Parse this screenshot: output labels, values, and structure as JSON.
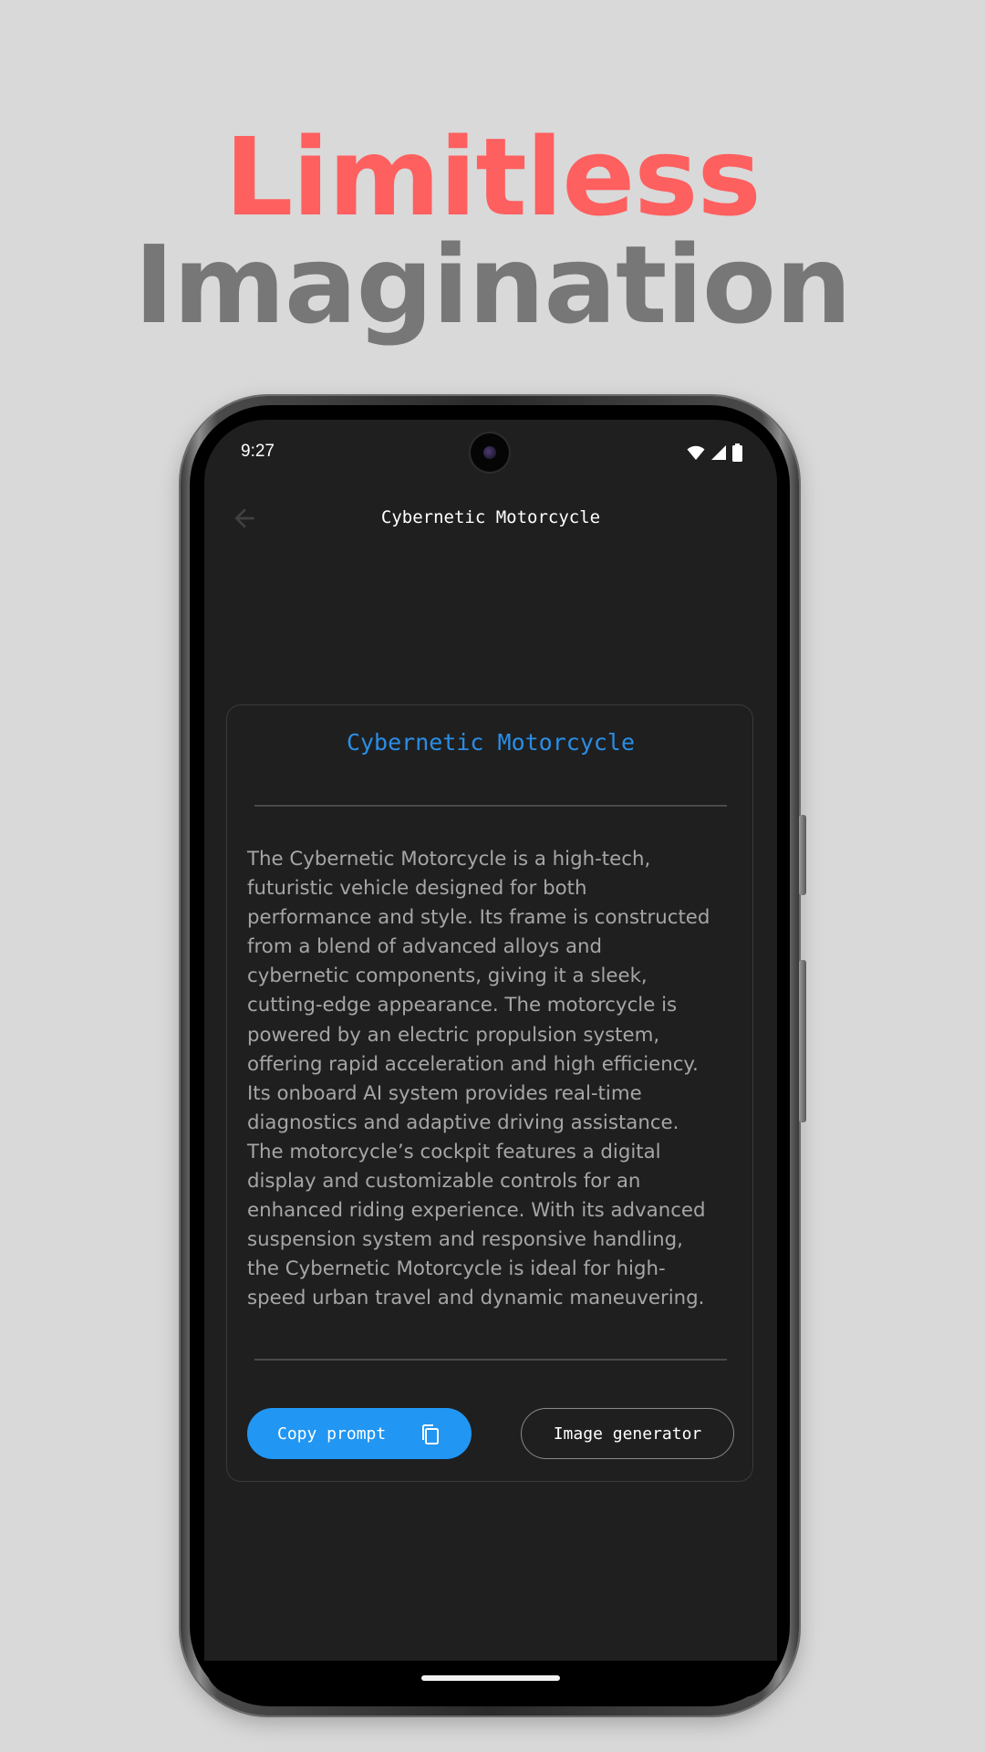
{
  "promo": {
    "headline_line1": "Limitless",
    "headline_line2": "Imagination"
  },
  "status_bar": {
    "time": "9:27",
    "icons": [
      "wifi-icon",
      "signal-icon",
      "battery-icon"
    ]
  },
  "app_bar": {
    "title": "Cybernetic Motorcycle",
    "back_icon": "arrow-back-icon"
  },
  "card": {
    "title": "Cybernetic Motorcycle",
    "description": "The Cybernetic Motorcycle is a high-tech,\nfuturistic vehicle designed for both\nperformance and style. Its frame is constructed\nfrom a blend of advanced alloys and\ncybernetic components, giving it a sleek,\ncutting-edge appearance. The motorcycle is\npowered by an electric propulsion system,\noffering rapid acceleration and high efficiency.\nIts onboard AI system provides real-time\ndiagnostics and adaptive driving assistance.\nThe motorcycle’s cockpit features a digital\ndisplay and customizable controls for an\nenhanced riding experience. With its advanced\nsuspension system and responsive handling,\nthe Cybernetic Motorcycle is ideal for high-\nspeed urban travel and dynamic maneuvering.",
    "copy_button_label": "Copy prompt",
    "copy_icon": "copy-icon",
    "generator_button_label": "Image generator"
  },
  "colors": {
    "background": "#d9d9d9",
    "headline_accent": "#fe5f5f",
    "headline_secondary": "#777777",
    "screen_background": "#1f1f1f",
    "title_blue": "#2a8ee6",
    "button_blue": "#2196f3",
    "body_text": "#a6a6a6"
  }
}
